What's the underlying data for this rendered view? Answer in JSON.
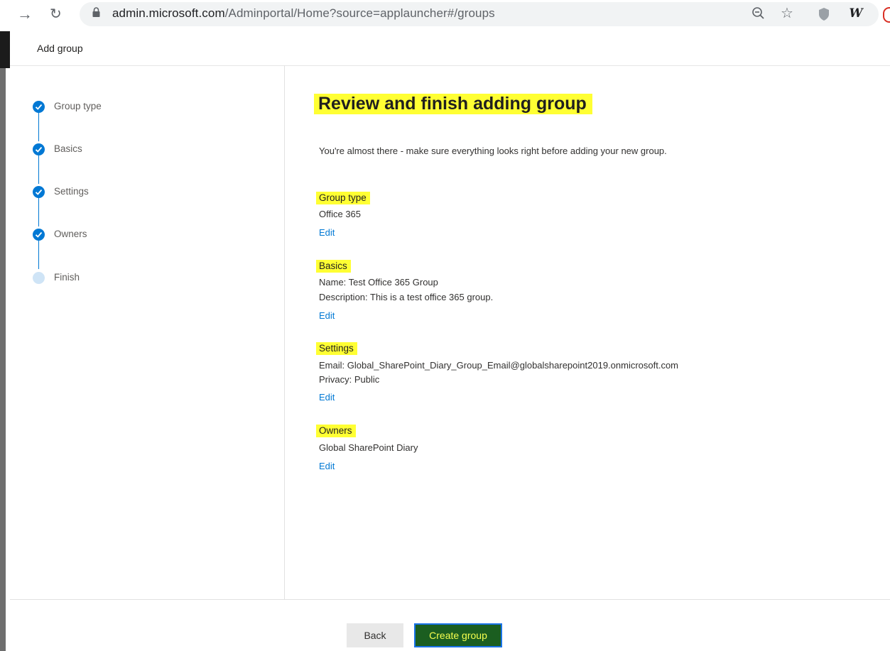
{
  "browser": {
    "url_host": "admin.microsoft.com",
    "url_path": "/Adminportal/Home?source=applauncher#/groups",
    "extension_letter": "W"
  },
  "panel": {
    "title": "Add group"
  },
  "steps": [
    {
      "label": "Group type",
      "status": "complete"
    },
    {
      "label": "Basics",
      "status": "complete"
    },
    {
      "label": "Settings",
      "status": "complete"
    },
    {
      "label": "Owners",
      "status": "complete"
    },
    {
      "label": "Finish",
      "status": "current"
    }
  ],
  "main": {
    "title": "Review and finish adding group",
    "intro": "You're almost there - make sure everything looks right before adding your new group.",
    "sections": {
      "group_type": {
        "heading": "Group type",
        "lines": [
          "Office 365"
        ],
        "edit_label": "Edit"
      },
      "basics": {
        "heading": "Basics",
        "lines": [
          "Name: Test Office 365 Group",
          "Description: This is a test office 365 group."
        ],
        "edit_label": "Edit"
      },
      "settings": {
        "heading": "Settings",
        "lines": [
          "Email: Global_SharePoint_Diary_Group_Email@globalsharepoint2019.onmicrosoft.com",
          "Privacy: Public"
        ],
        "edit_label": "Edit"
      },
      "owners": {
        "heading": "Owners",
        "lines": [
          "Global SharePoint Diary"
        ],
        "edit_label": "Edit"
      }
    }
  },
  "footer": {
    "back_label": "Back",
    "create_label": "Create group"
  },
  "colors": {
    "accent": "#0078d4",
    "highlight": "#ffff33",
    "create_button_bg": "#1b5e20",
    "create_button_text": "#f6ff4f"
  }
}
